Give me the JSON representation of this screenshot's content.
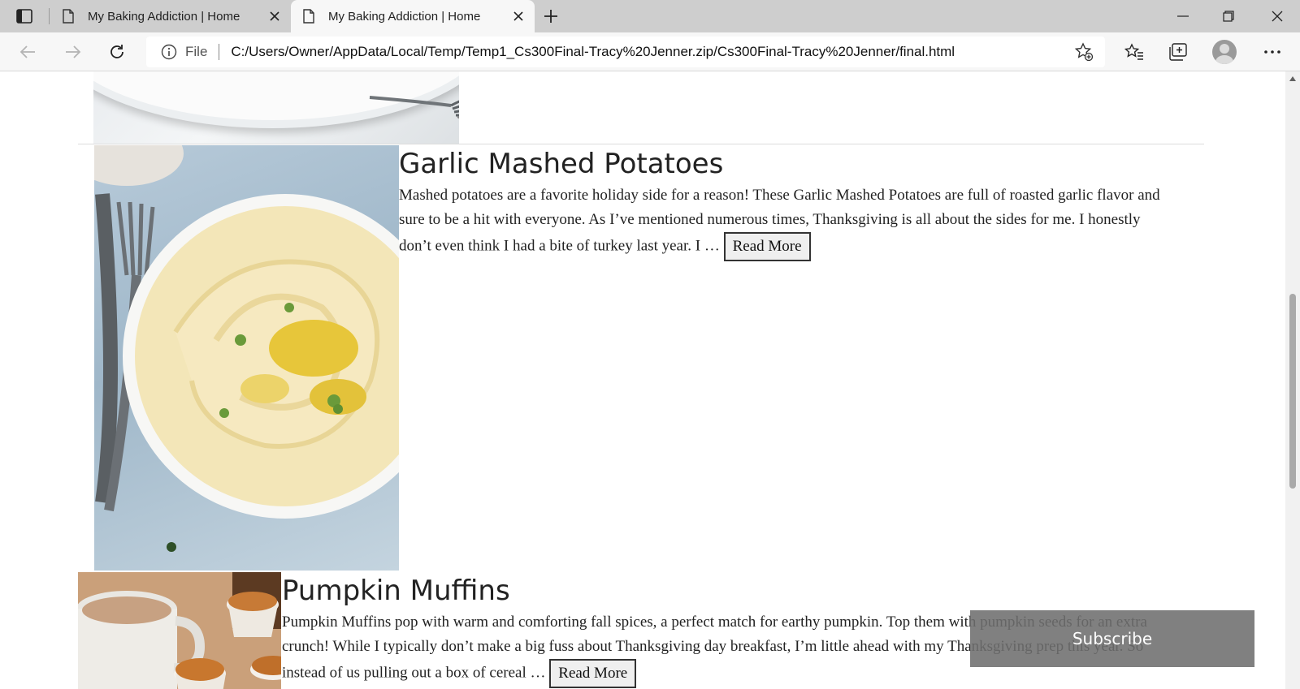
{
  "browser": {
    "tabs": [
      {
        "title": "My Baking Addiction | Home",
        "active": false
      },
      {
        "title": "My Baking Addiction | Home",
        "active": true
      }
    ],
    "address": {
      "scheme_label": "File",
      "url": "C:/Users/Owner/AppData/Local/Temp/Temp1_Cs300Final-Tracy%20Jenner.zip/Cs300Final-Tracy%20Jenner/final.html"
    }
  },
  "posts": [
    {
      "title": "Garlic Mashed Potatoes",
      "excerpt": "Mashed potatoes are a favorite holiday side for a reason! These Garlic Mashed Potatoes are full of roasted garlic flavor and sure to be a hit with everyone. As I’ve mentioned numerous times, Thanksgiving is all about the sides for me. I honestly don’t even think I had a bite of turkey last year. I …",
      "read_more": "Read More"
    },
    {
      "title": "Pumpkin Muffins",
      "excerpt": "Pumpkin Muffins pop with warm and comforting fall spices, a perfect match for earthy pumpkin. Top them with pumpkin seeds for an extra crunch! While I typically don’t make a big fuss about Thanksgiving day breakfast, I’m little ahead with my Thanksgiving prep this year. So instead of us pulling out a box of cereal …",
      "read_more": "Read More"
    }
  ],
  "subscribe": {
    "label": "Subscribe"
  }
}
